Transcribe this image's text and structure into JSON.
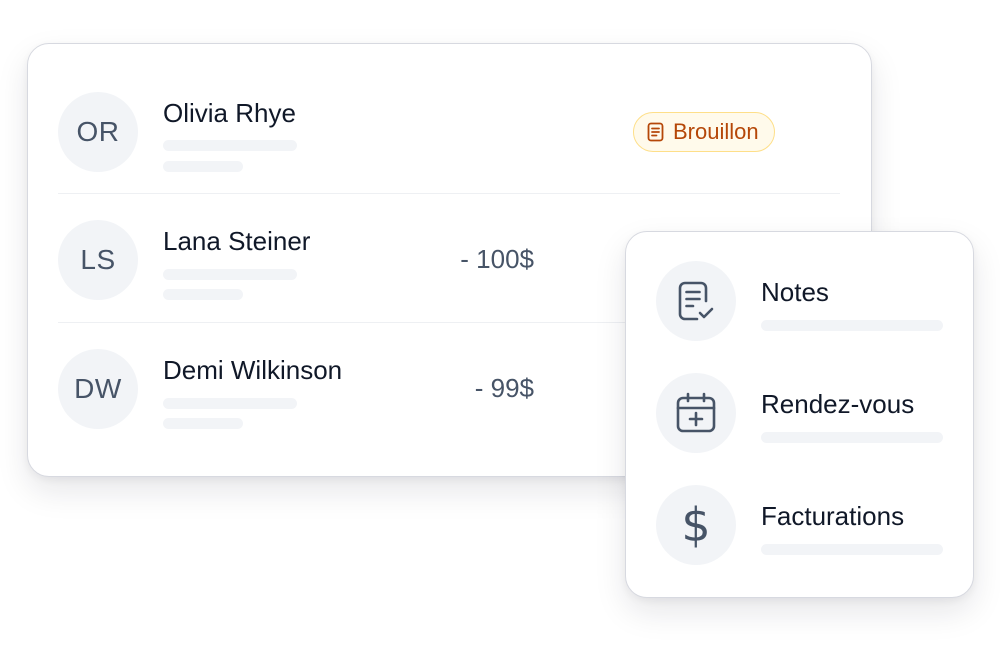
{
  "clients": [
    {
      "initials": "OR",
      "name": "Olivia Rhye",
      "amount": "",
      "badge": "Brouillon"
    },
    {
      "initials": "LS",
      "name": "Lana Steiner",
      "amount": "- 100$"
    },
    {
      "initials": "DW",
      "name": "Demi Wilkinson",
      "amount": "- 99$"
    }
  ],
  "menu": {
    "items": [
      {
        "label": "Notes",
        "icon": "notes-check-icon"
      },
      {
        "label": "Rendez-vous",
        "icon": "calendar-plus-icon"
      },
      {
        "label": "Facturations",
        "icon": "dollar-icon",
        "glyph": "$"
      }
    ]
  },
  "colors": {
    "badge_text": "#b54708",
    "badge_bg": "#fffaeb",
    "badge_border": "#fedf89",
    "avatar_bg": "#f2f4f7",
    "muted_text": "#475467",
    "primary_text": "#101828"
  }
}
